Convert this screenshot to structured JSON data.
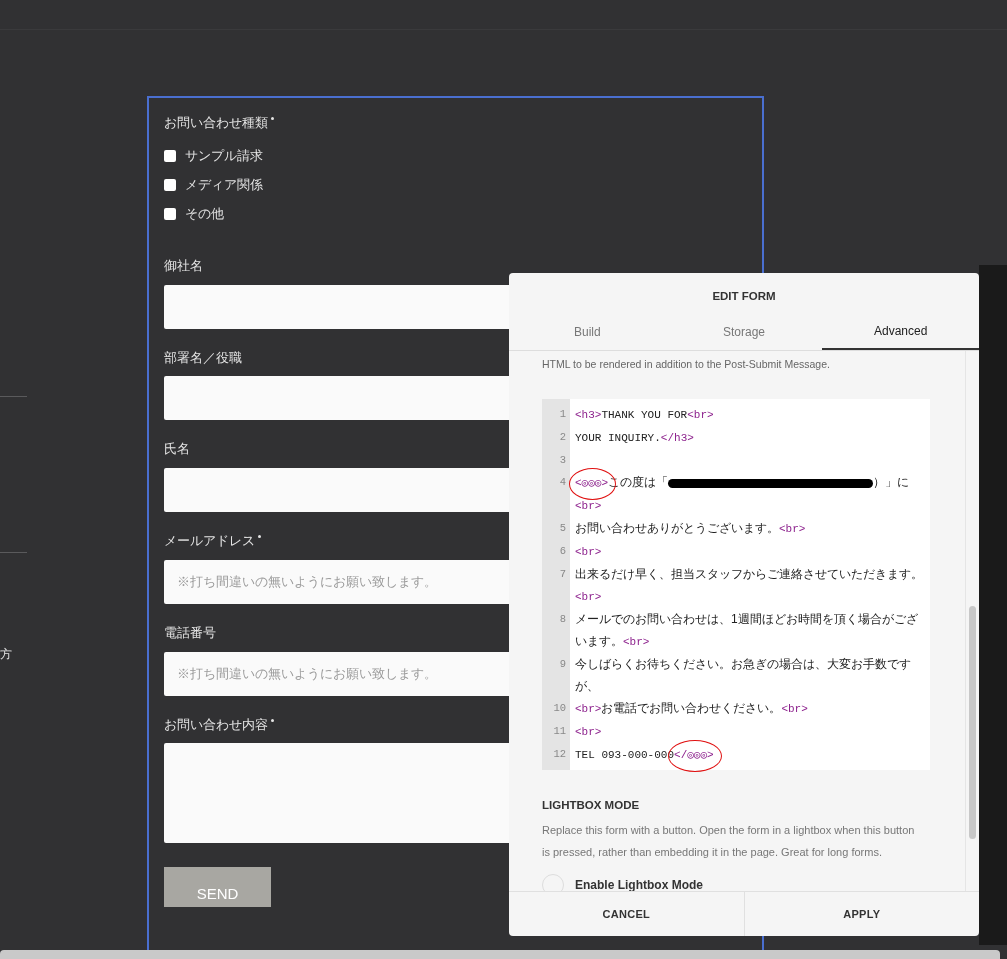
{
  "page": {
    "side_text": "方"
  },
  "form": {
    "fields": [
      {
        "kind": "checkboxes",
        "label": "お問い合わせ種類",
        "required": true,
        "options": [
          {
            "label": "サンプル請求",
            "checked": false
          },
          {
            "label": "メディア関係",
            "checked": false
          },
          {
            "label": "その他",
            "checked": false
          }
        ]
      },
      {
        "kind": "text",
        "label": "御社名",
        "required": false
      },
      {
        "kind": "text",
        "label": "部署名／役職",
        "required": false
      },
      {
        "kind": "text",
        "label": "氏名",
        "required": false
      },
      {
        "kind": "text",
        "label": "メールアドレス",
        "required": true,
        "placeholder": "※打ち間違いの無いようにお願い致します。"
      },
      {
        "kind": "text",
        "label": "電話番号",
        "required": false,
        "placeholder": "※打ち間違いの無いようにお願い致します。"
      },
      {
        "kind": "textarea",
        "label": "お問い合わせ内容",
        "required": true
      }
    ],
    "submit": "SEND"
  },
  "dialog": {
    "title": "EDIT FORM",
    "tabs": [
      {
        "label": "Build",
        "selected": false
      },
      {
        "label": "Storage",
        "selected": false
      },
      {
        "label": "Advanced",
        "selected": true
      }
    ],
    "help": "HTML to be rendered in addition to the Post-Submit Message.",
    "code_lines": [
      {
        "number": "1",
        "segments": [
          {
            "kind": "tag",
            "text": "<h3>"
          },
          {
            "kind": "text",
            "text": "THANK YOU FOR"
          },
          {
            "kind": "tag",
            "text": "<br>"
          }
        ]
      },
      {
        "number": "2",
        "segments": [
          {
            "kind": "text",
            "text": "YOUR INQUIRY."
          },
          {
            "kind": "tag",
            "text": "</h3>"
          }
        ]
      },
      {
        "number": "3"
      },
      {
        "number": "4",
        "segments": [
          {
            "kind": "tag",
            "text": "<◎◎◎>",
            "circled": true
          },
          {
            "kind": "text",
            "text": "この度は「"
          },
          {
            "kind": "redacted"
          },
          {
            "kind": "text",
            "text": "）」に"
          },
          {
            "kind": "tag",
            "text": "<br>"
          }
        ]
      },
      {
        "number": "5",
        "segments": [
          {
            "kind": "text",
            "text": "お問い合わせありがとうございます。"
          },
          {
            "kind": "tag",
            "text": "<br>"
          }
        ]
      },
      {
        "number": "6",
        "segments": [
          {
            "kind": "tag",
            "text": "<br>"
          }
        ]
      },
      {
        "number": "7",
        "segments": [
          {
            "kind": "text",
            "text": "出来るだけ早く、担当スタッフからご連絡させていただきます。"
          },
          {
            "kind": "tag",
            "text": "<br>"
          }
        ]
      },
      {
        "number": "8",
        "segments": [
          {
            "kind": "text",
            "text": "メールでのお問い合わせは、1週間ほどお時間を頂く場合がございます。"
          },
          {
            "kind": "tag",
            "text": "<br>"
          }
        ]
      },
      {
        "number": "9",
        "segments": [
          {
            "kind": "text",
            "text": "今しばらくお待ちください。お急ぎの場合は、大変お手数ですが、"
          }
        ]
      },
      {
        "number": "10",
        "segments": [
          {
            "kind": "tag",
            "text": "<br>"
          },
          {
            "kind": "text",
            "text": "お電話でお問い合わせください。"
          },
          {
            "kind": "tag",
            "text": "<br>"
          }
        ]
      },
      {
        "number": "11",
        "segments": [
          {
            "kind": "tag",
            "text": "<br>"
          }
        ]
      },
      {
        "number": "12",
        "segments": [
          {
            "kind": "text",
            "text": "TEL 093-000-000"
          },
          {
            "kind": "tag",
            "text": "</◎◎◎>",
            "circled": true
          }
        ]
      }
    ],
    "lightbox": {
      "heading": "LIGHTBOX MODE",
      "description": "Replace this form with a button. Open the form in a lightbox when this button is pressed, rather than embedding it in the page. Great for long forms.",
      "toggle_label": "Enable Lightbox Mode",
      "on": false
    },
    "buttons": [
      "CANCEL",
      "APPLY"
    ]
  }
}
